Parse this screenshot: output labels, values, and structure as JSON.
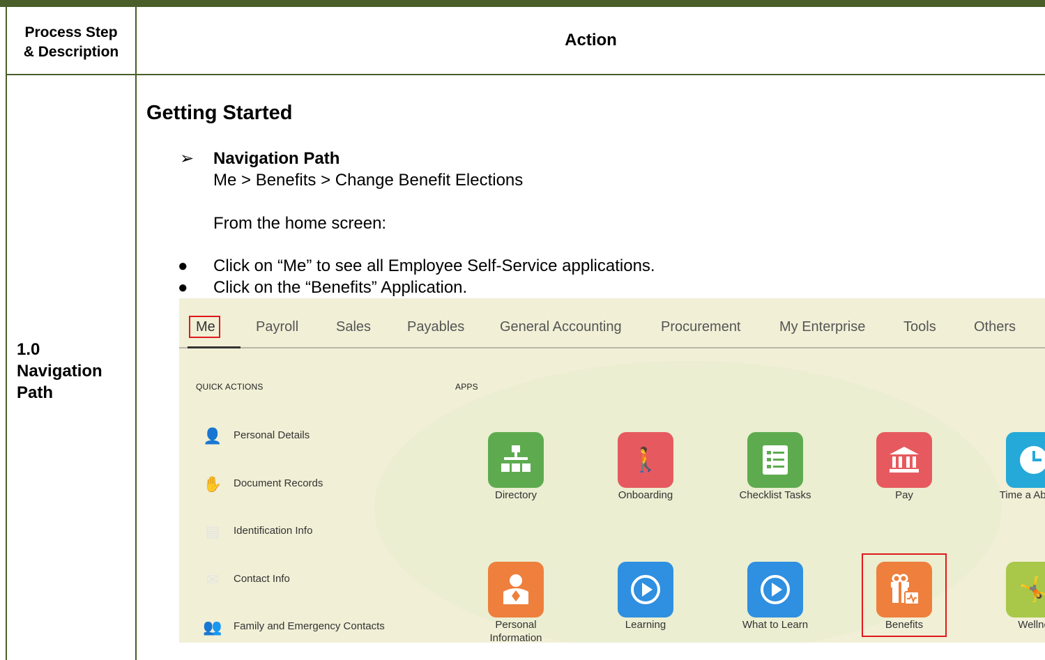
{
  "header": {
    "col1_line1": "Process Step",
    "col1_line2": "& Description",
    "col2": "Action"
  },
  "step": {
    "line1": "1.0",
    "line2": "Navigation",
    "line3": "Path"
  },
  "content": {
    "heading": "Getting Started",
    "nav_arrow": "➢",
    "nav_title": "Navigation Path",
    "nav_path": "Me > Benefits > Change Benefit Elections",
    "intro": "From the home screen:",
    "bullet_glyph": "●",
    "bullets": [
      "Click on “Me” to see all Employee Self-Service applications.",
      "Click on the “Benefits” Application."
    ]
  },
  "screenshot": {
    "tabs": [
      "Me",
      "Payroll",
      "Sales",
      "Payables",
      "General Accounting",
      "Procurement",
      "My Enterprise",
      "Tools",
      "Others"
    ],
    "quick_actions_label": "QUICK ACTIONS",
    "apps_label": "APPS",
    "quick_actions": [
      {
        "label": "Personal Details",
        "icon": "person-icon"
      },
      {
        "label": "Document Records",
        "icon": "hand-document-icon"
      },
      {
        "label": "Identification Info",
        "icon": "id-document-icon"
      },
      {
        "label": "Contact Info",
        "icon": "envelope-icon"
      },
      {
        "label": "Family and Emergency Contacts",
        "icon": "family-icon"
      }
    ],
    "apps": [
      {
        "label": "Directory",
        "icon": "org-chart-icon",
        "color": "#5eab4f"
      },
      {
        "label": "Onboarding",
        "icon": "people-walking-icon",
        "color": "#e65a5f"
      },
      {
        "label": "Checklist Tasks",
        "icon": "checklist-icon",
        "color": "#5eab4f"
      },
      {
        "label": "Pay",
        "icon": "bank-icon",
        "color": "#e65a5f"
      },
      {
        "label": "Time a Absenc",
        "icon": "clock-icon",
        "color": "#25a9d8"
      },
      {
        "label": "Personal Information",
        "icon": "person-icon",
        "color": "#ee7f3c"
      },
      {
        "label": "Learning",
        "icon": "play-icon",
        "color": "#2f8fe0"
      },
      {
        "label": "What to Learn",
        "icon": "play-icon",
        "color": "#2f8fe0"
      },
      {
        "label": "Benefits",
        "icon": "gift-icon",
        "color": "#ee7f3c"
      },
      {
        "label": "Wellne",
        "icon": "wellness-icon",
        "color": "#a9c84a"
      }
    ]
  }
}
